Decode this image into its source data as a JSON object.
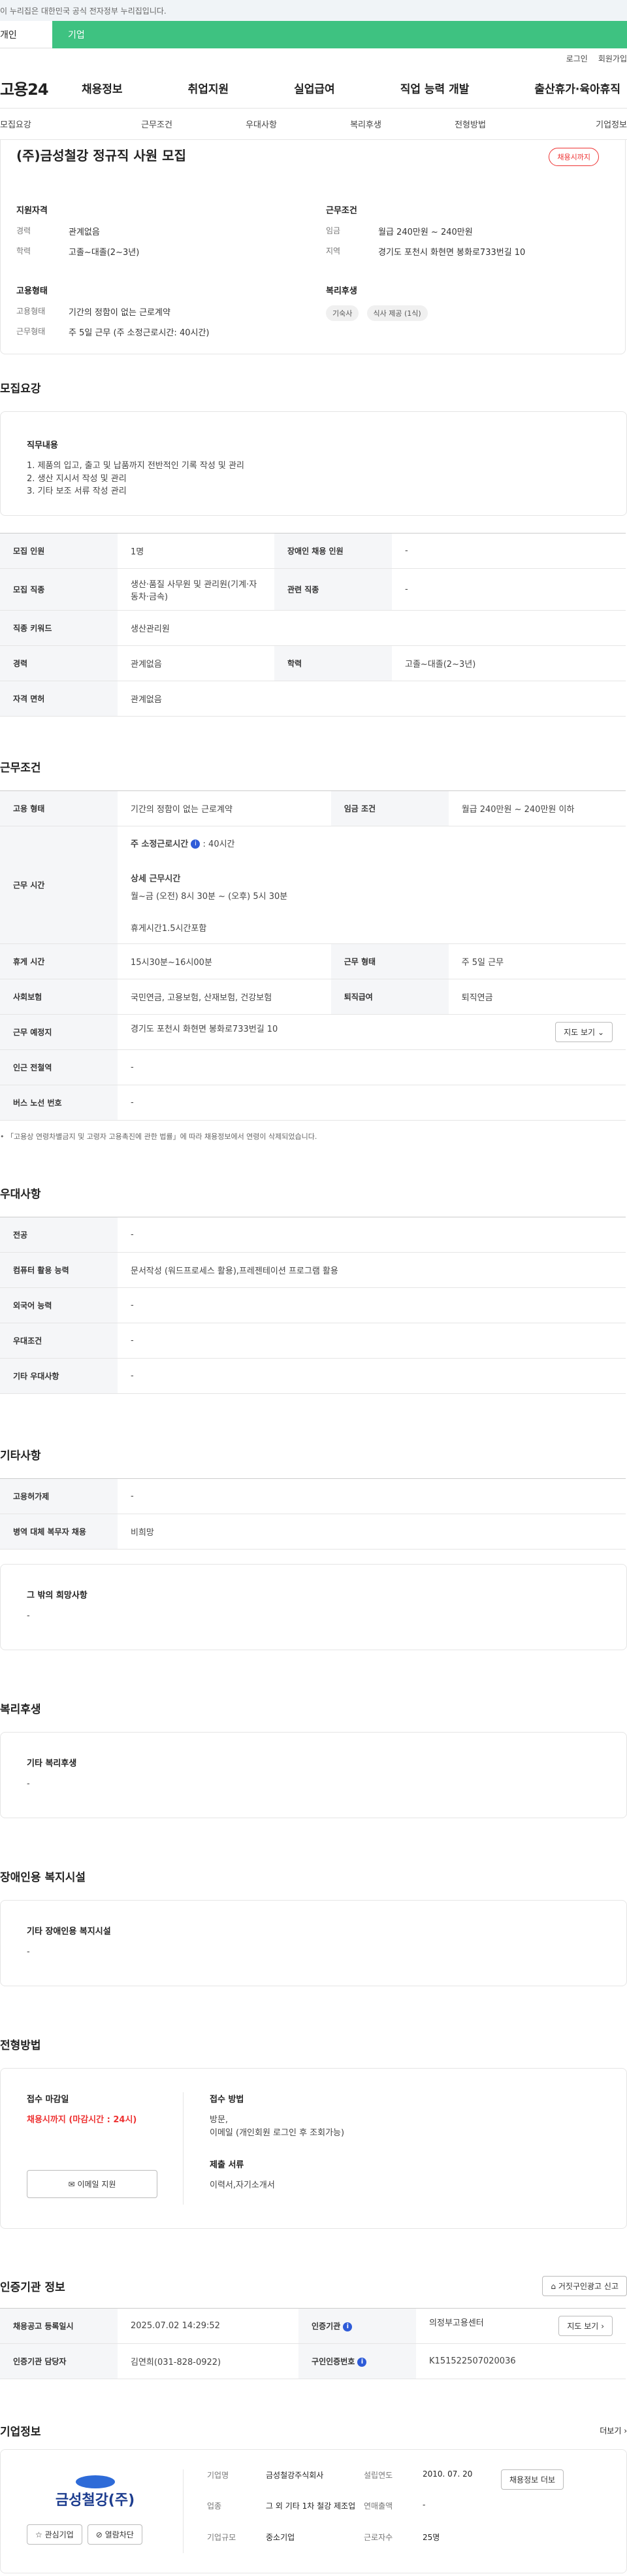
{
  "gov_notice": "이 누리집은 대한민국 공식 전자정부 누리집입니다.",
  "tabs": {
    "individual": "개인",
    "enterprise": "기업"
  },
  "util": {
    "login": "로그인",
    "join": "회원가입"
  },
  "gnb": {
    "logo": "고용24",
    "menu": [
      "채용정보",
      "취업지원",
      "실업급여",
      "직업 능력 개발",
      "출산휴가·육아휴직"
    ]
  },
  "snb": [
    "모집요강",
    "근무조건",
    "우대사항",
    "복리후생",
    "전형방법",
    "기업정보"
  ],
  "summary": {
    "title": "(주)금성철강 정규직 사원 모집",
    "badge": "채용시까지",
    "qual_title": "지원자격",
    "career_k": "경력",
    "career_v": "관계없음",
    "edu_k": "학력",
    "edu_v": "고졸~대졸(2~3년)",
    "emp_title": "고용형태",
    "emptype_k": "고용형태",
    "emptype_v": "기간의 정함이 없는 근로계약",
    "worktype_k": "근무형태",
    "worktype_v": "주 5일 근무 (주 소정근로시간: 40시간)",
    "cond_title": "근무조건",
    "wage_k": "임금",
    "wage_v": "월급 240만원 ~ 240만원",
    "region_k": "지역",
    "region_v": "경기도 포천시 화현면 봉화로733번길 10",
    "welfare_title": "복리후생",
    "tags": [
      "기숙사",
      "식사 제공 (1식)"
    ]
  },
  "recruit": {
    "title": "모집요강",
    "duty_title": "직무내용",
    "duty_lines": [
      "1. 제품의 입고, 출고 및 납품까지 전반적인 기록 작성 및 관리",
      "2. 생산 지시서 작성 및 관리",
      "3. 기타 보조 서류 작성 관리"
    ],
    "rows": {
      "count_k": "모집 인원",
      "count_v": "1명",
      "disabled_k": "장애인 채용 인원",
      "disabled_v": "-",
      "job_k": "모집 직종",
      "job_v": "생산·품질 사무원 및 관리원(기계·자동차·금속)",
      "related_k": "관련 직종",
      "related_v": "-",
      "keyword_k": "직종 키워드",
      "keyword_v": "생산관리원",
      "career_k": "경력",
      "career_v": "관계없음",
      "edu_k": "학력",
      "edu_v": "고졸~대졸(2~3년)",
      "license_k": "자격 면허",
      "license_v": "관계없음"
    }
  },
  "work": {
    "title": "근무조건",
    "emptype_k": "고용 형태",
    "emptype_v": "기간의 정함이 없는 근로계약",
    "wage_k": "임금 조건",
    "wage_v": "월급 240만원 ~ 240만원 이하",
    "hours_k": "근무 시간",
    "hours_std": "주 소정근로시간",
    "hours_std_v": ": 40시간",
    "hours_detail_t": "상세 근무시간",
    "hours_detail_v": "월~금 (오전) 8시 30분 ~ (오후) 5시 30분",
    "hours_break": "휴게시간1.5시간포함",
    "break_k": "휴게 시간",
    "break_v": "15시30분~16시00분",
    "form_k": "근무 형태",
    "form_v": "주 5일 근무",
    "ins_k": "사회보험",
    "ins_v": "국민연금, 고용보험, 산재보험, 건강보험",
    "sev_k": "퇴직급여",
    "sev_v": "퇴직연금",
    "loc_k": "근무 예정지",
    "loc_v": "경기도 포천시 화현면 봉화로733번길 10",
    "map_btn": "지도 보기",
    "subway_k": "인근 전철역",
    "subway_v": "-",
    "bus_k": "버스 노선 번호",
    "bus_v": "-",
    "note": "「고용상 연령차별금지 및 고령자 고용촉진에 관한 법률」에 따라 채용정보에서 연령이 삭제되었습니다."
  },
  "pref": {
    "title": "우대사항",
    "major_k": "전공",
    "major_v": "-",
    "pc_k": "컴퓨터 활용 능력",
    "pc_v": "문서작성 (워드프로세스 활용),프레젠테이션 프로그램 활용",
    "lang_k": "외국어 능력",
    "lang_v": "-",
    "cond_k": "우대조건",
    "cond_v": "-",
    "etc_k": "기타 우대사항",
    "etc_v": "-"
  },
  "etc": {
    "title": "기타사항",
    "emp_k": "고용허가제",
    "emp_v": "-",
    "mil_k": "병역 대체 복무자 채용",
    "mil_v": "비희망",
    "hope_t": "그 밖의 희망사항",
    "hope_v": "-"
  },
  "welfare": {
    "title": "복리후생",
    "box_t": "기타 복리후생",
    "box_v": "-"
  },
  "disabled": {
    "title": "장애인용 복지시설",
    "box_t": "기타 장애인용 복지시설",
    "box_v": "-"
  },
  "select": {
    "title": "전형방법",
    "deadline_t": "접수 마감일",
    "deadline_v": "채용시까지 (마감시간 : 24시)",
    "email_btn": "이메일 지원",
    "method_t": "접수 방법",
    "method_v1": "방문,",
    "method_v2": "이메일 (개인회원 로그인 후 조회가능)",
    "docs_t": "제출 서류",
    "docs_v": "이력서,자기소개서"
  },
  "cert": {
    "title": "인증기관 정보",
    "report_btn": "거짓구인광고 신고",
    "reg_k": "채용공고 등록일시",
    "reg_v": "2025.07.02 14:29:52",
    "org_k": "인증기관",
    "org_v": "의정부고용센터",
    "map_btn": "지도 보기",
    "mgr_k": "인증기관 담당자",
    "mgr_v": "김연희(031-828-0922)",
    "no_k": "구인인증번호",
    "no_v": "K151522507020036"
  },
  "company": {
    "title": "기업정보",
    "more": "더보기",
    "logo_text": "금성철강(주)",
    "fav_btn": "관심기업",
    "block_btn": "열람차단",
    "name_k": "기업명",
    "name_v": "금성철강주식회사",
    "est_k": "설립연도",
    "est_v": "2010. 07. 20",
    "ind_k": "업종",
    "ind_v": "그 외 기타 1차 철강 제조업",
    "sales_k": "연매출액",
    "sales_v": "-",
    "emp_k": "근로자수",
    "emp_v": "25명",
    "size_k": "기업규모",
    "size_v": "중소기업",
    "recruit_btn": "채용정보 더보"
  }
}
